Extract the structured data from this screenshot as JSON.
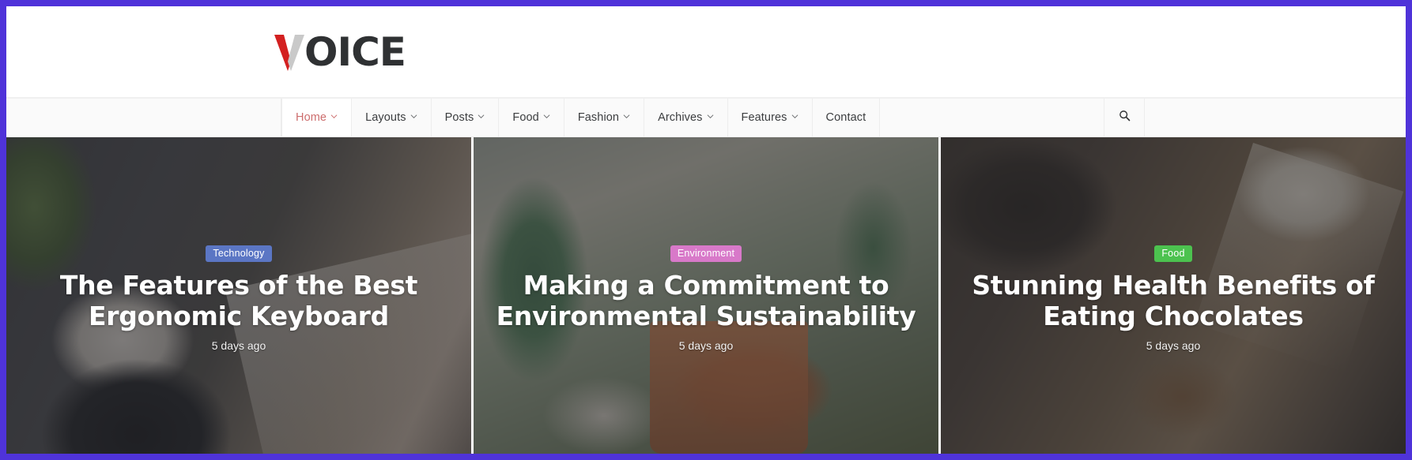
{
  "frame": {
    "border_color": "#4f33d9"
  },
  "header": {
    "logo": {
      "accent_char": "V",
      "text": "OICE",
      "full": "VOICE",
      "accent_color": "#d32020",
      "secondary_color": "#c9c9c9",
      "text_color": "#2f3133"
    }
  },
  "nav": {
    "items": [
      {
        "label": "Home",
        "has_caret": true,
        "active": true
      },
      {
        "label": "Layouts",
        "has_caret": true,
        "active": false
      },
      {
        "label": "Posts",
        "has_caret": true,
        "active": false
      },
      {
        "label": "Food",
        "has_caret": true,
        "active": false
      },
      {
        "label": "Fashion",
        "has_caret": true,
        "active": false
      },
      {
        "label": "Archives",
        "has_caret": true,
        "active": false
      },
      {
        "label": "Features",
        "has_caret": true,
        "active": false
      },
      {
        "label": "Contact",
        "has_caret": false,
        "active": false
      }
    ],
    "search_icon": "search-icon",
    "active_color": "#cd6e6e",
    "text_color": "#3b3d3f",
    "background": "#fafafa"
  },
  "hero": {
    "cards": [
      {
        "badge": "Technology",
        "badge_color": "#5b76c4",
        "title": "The Features of the Best Ergonomic Keyboard",
        "meta": "5 days ago",
        "image_alt": "magazine-and-coffee-on-desk"
      },
      {
        "badge": "Environment",
        "badge_color": "#d879c9",
        "title": "Making a Commitment to Environmental Sustainability",
        "meta": "5 days ago",
        "image_alt": "potted-cactus-plants"
      },
      {
        "badge": "Food",
        "badge_color": "#4cc24f",
        "title": "Stunning Health Benefits of Eating Chocolates",
        "meta": "5 days ago",
        "image_alt": "chocolate-pieces-and-spoon-on-wood"
      }
    ]
  }
}
